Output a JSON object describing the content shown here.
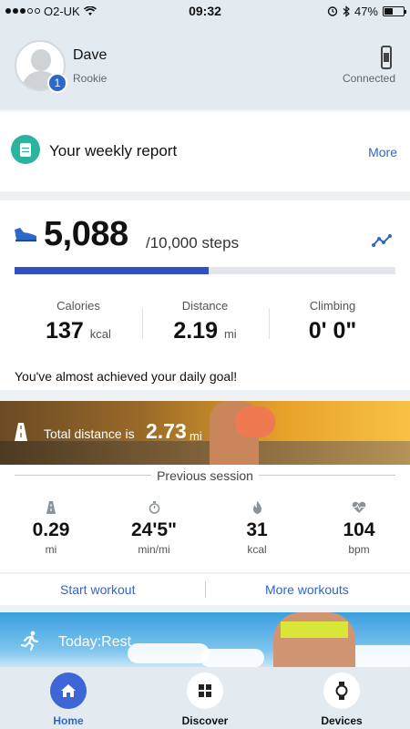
{
  "status_bar": {
    "carrier": "O2-UK",
    "time": "09:32",
    "battery": "47%",
    "battery_level": 0.47
  },
  "profile": {
    "name": "Dave",
    "rank": "Rookie",
    "level": "1",
    "device_status": "Connected"
  },
  "weekly_report": {
    "title": "Your weekly report",
    "more_label": "More"
  },
  "steps": {
    "count": "5,088",
    "goal": "/10,000 steps",
    "progress": 0.5088,
    "stats": [
      {
        "label": "Calories",
        "value": "137",
        "unit": "kcal"
      },
      {
        "label": "Distance",
        "value": "2.19",
        "unit": "mi"
      },
      {
        "label": "Climbing",
        "value": "0' 0\"",
        "unit": ""
      }
    ],
    "message": "You've almost achieved your daily goal!"
  },
  "total_distance": {
    "label": "Total distance is",
    "value": "2.73",
    "unit": "mi"
  },
  "previous_session": {
    "title": "Previous session",
    "metrics": [
      {
        "icon": "road-icon",
        "value": "0.29",
        "unit": "mi"
      },
      {
        "icon": "stopwatch-icon",
        "value": "24'5\"",
        "unit": "min/mi"
      },
      {
        "icon": "flame-icon",
        "value": "31",
        "unit": "kcal"
      },
      {
        "icon": "heart-rate-icon",
        "value": "104",
        "unit": "bpm"
      }
    ]
  },
  "actions": {
    "start": "Start workout",
    "more": "More workouts"
  },
  "today": {
    "label": "Today:Rest"
  },
  "nav": {
    "home": "Home",
    "discover": "Discover",
    "devices": "Devices"
  },
  "colors": {
    "accent": "#2d67c8",
    "progress": "#2f4fc2",
    "report_icon": "#2bb3a0",
    "nav_active": "#3f66d6"
  }
}
